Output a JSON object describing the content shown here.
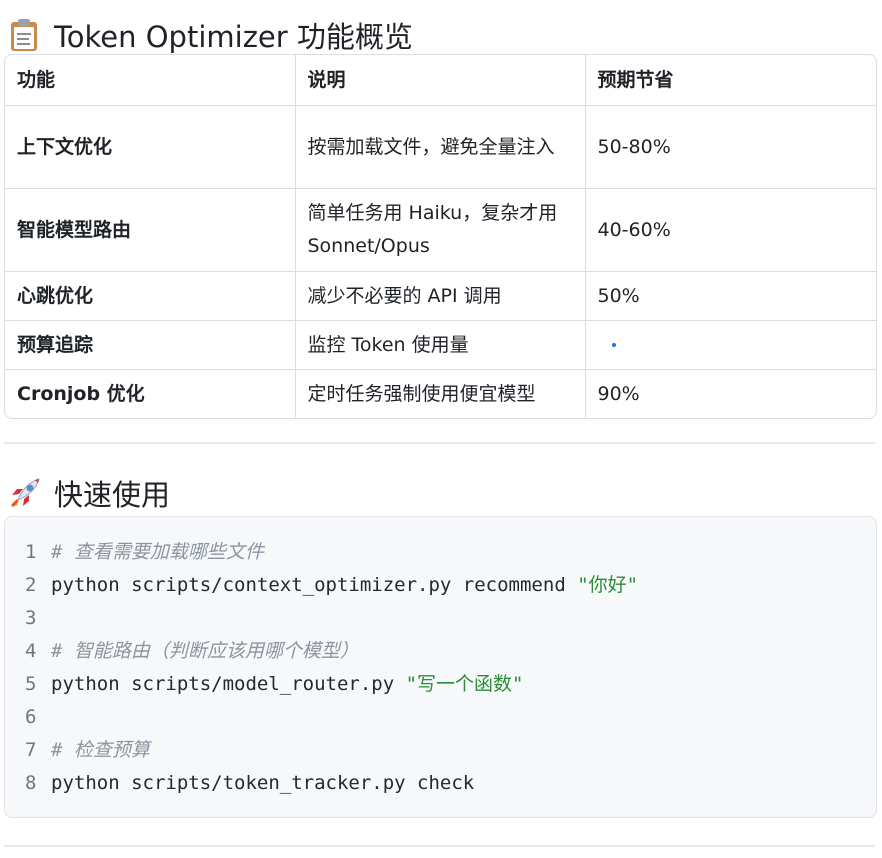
{
  "section1": {
    "title": "Token Optimizer 功能概览",
    "icon": "clipboard-icon"
  },
  "table": {
    "headers": [
      "功能",
      "说明",
      "预期节省"
    ],
    "rows": [
      {
        "feature": "上下文优化",
        "desc": "按需加载文件，避免全量注入",
        "saving": "50-80%"
      },
      {
        "feature": "智能模型路由",
        "desc": "简单任务用 Haiku，复杂才用 Sonnet/Opus",
        "saving": "40-60%"
      },
      {
        "feature": "心跳优化",
        "desc": "减少不必要的 API 调用",
        "saving": "50%"
      },
      {
        "feature": "预算追踪",
        "desc": "监控 Token 使用量",
        "saving": ""
      },
      {
        "feature": "Cronjob 优化",
        "desc": "定时任务强制使用便宜模型",
        "saving": "90%"
      }
    ]
  },
  "section2": {
    "title": "快速使用",
    "icon": "rocket-icon"
  },
  "code": {
    "lines": [
      {
        "num": "1",
        "comment": "# 查看需要加载哪些文件",
        "text": "",
        "string": ""
      },
      {
        "num": "2",
        "comment": "",
        "text": "python scripts/context_optimizer.py recommend ",
        "string": "\"你好\""
      },
      {
        "num": "3",
        "comment": "",
        "text": "",
        "string": ""
      },
      {
        "num": "4",
        "comment": "# 智能路由（判断应该用哪个模型）",
        "text": "",
        "string": ""
      },
      {
        "num": "5",
        "comment": "",
        "text": "python scripts/model_router.py ",
        "string": "\"写一个函数\""
      },
      {
        "num": "6",
        "comment": "",
        "text": "",
        "string": ""
      },
      {
        "num": "7",
        "comment": "# 检查预算",
        "text": "",
        "string": ""
      },
      {
        "num": "8",
        "comment": "",
        "text": "python scripts/token_tracker.py check",
        "string": ""
      }
    ]
  },
  "colors": {
    "comment": "#8c959f",
    "string": "#2e8b3a",
    "border": "#d8dee4",
    "code_bg": "#f6f8fa"
  }
}
